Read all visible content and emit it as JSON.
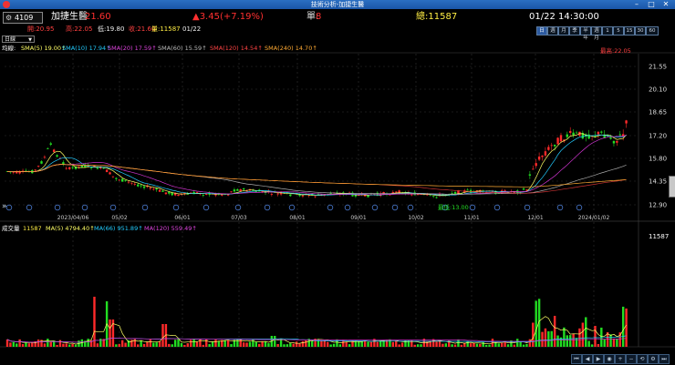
{
  "window": {
    "title": "技術分析-加捷生醫"
  },
  "header": {
    "code": "4109",
    "name": "加捷生醫",
    "price": "21.60",
    "change": "▲3.45(+7.19%)",
    "odd_label": "單:",
    "odd_value": "8",
    "total_volume": "總:11587",
    "datetime": "01/22 14:30:00"
  },
  "ohlc": {
    "open": "開:20.95",
    "high": "高:22.05",
    "low": "低:19.80",
    "close": "收:21.60",
    "volume": "量:11587",
    "date": "01/22"
  },
  "timeframes": [
    "日",
    "週",
    "月",
    "季",
    "半年",
    "週月",
    "1",
    "5",
    "15",
    "30",
    "60"
  ],
  "period": {
    "label": "日線"
  },
  "ma_legend": {
    "title": "均線:",
    "sma5": "SMA(5) 19.00↑",
    "sma10": "SMA(10) 17.94↑",
    "sma20": "SMA(20) 17.59↑",
    "sma60": "SMA(60) 15.59↑",
    "sma120": "SMA(120) 14.54↑",
    "sma240": "SMA(240) 14.70↑"
  },
  "price_axis": [
    "21.55",
    "20.10",
    "18.65",
    "17.20",
    "15.80",
    "14.35",
    "12.90"
  ],
  "date_axis": [
    "2023/04/06",
    "05/02",
    "06/01",
    "07/03",
    "08/01",
    "09/01",
    "10/02",
    "11/01",
    "12/01",
    "2024/01/02"
  ],
  "annotations": {
    "high": "最高:22.05",
    "low": "最低:13.00"
  },
  "volume_legend": {
    "title": "成交量",
    "value": "11587",
    "ma5": "MA(5) 4794.40↑",
    "ma66": "MA(66) 951.89↑",
    "ma120": "MA(120) 559.49↑"
  },
  "volume_axis": {
    "max": "11587"
  },
  "colors": {
    "up": "#ff2a2a",
    "down": "#22dd22",
    "sma5": "#ffff66",
    "sma10": "#22ccff",
    "sma20": "#cc33cc",
    "sma60": "#aaaaaa",
    "sma120": "#cc3333",
    "sma240": "#ffaa33"
  }
}
